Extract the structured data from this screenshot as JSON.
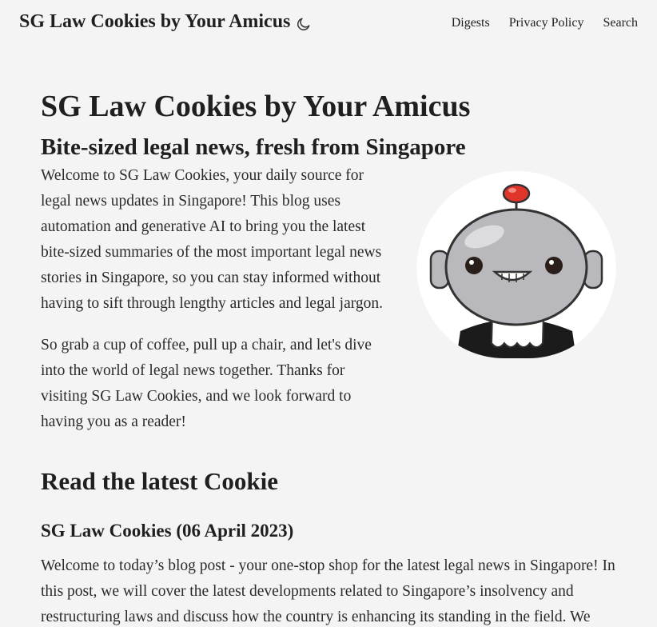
{
  "header": {
    "site_title": "SG Law Cookies by Your Amicus",
    "theme_icon": "moon-icon",
    "nav": [
      "Digests",
      "Privacy Policy",
      "Search"
    ]
  },
  "hero": {
    "title": "SG Law Cookies by Your Amicus",
    "subtitle": "Bite-sized legal news, fresh from Singapore",
    "paragraphs": [
      "Welcome to SG Law Cookies, your daily source for legal news updates in Singapore! This blog uses automation and generative AI to bring you the latest bite-sized summaries of the most important legal news stories in Singapore, so you can stay informed without having to sift through lengthy articles and legal jargon.",
      "So grab a cup of coffee, pull up a chair, and let's dive into the world of legal news together. Thanks for visiting SG Law Cookies, and we look forward to having you as a reader!"
    ],
    "avatar_icon": "robot-mascot-icon"
  },
  "latest": {
    "heading": "Read the latest Cookie",
    "post_title": "SG Law Cookies (06 April 2023)",
    "post_excerpt": "Welcome to today’s blog post - your one-stop shop for the latest legal news in Singapore! In this post, we will cover the latest developments related to Singapore’s insolvency and restructuring laws and discuss how the country is enhancing its standing in the field. We"
  },
  "colors": {
    "background": "#f4f4f4",
    "text": "#1f1f1f",
    "robot_body": "#b9b9bd",
    "robot_antenna": "#e0352b"
  }
}
